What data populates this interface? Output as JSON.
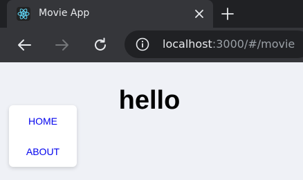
{
  "browser": {
    "tab": {
      "title": "Movie App",
      "favicon_icon": "react-logo-icon"
    },
    "address_bar": {
      "host": "localhost",
      "rest": ":3000/#/movie"
    }
  },
  "page": {
    "heading": "hello",
    "nav": {
      "home": "HOME",
      "about": "ABOUT"
    }
  },
  "colors": {
    "tabbar_bg": "#202124",
    "toolbar_bg": "#35363a",
    "page_bg": "#eff1f6",
    "link": "#0000ee",
    "react_logo": "#61dafb"
  }
}
